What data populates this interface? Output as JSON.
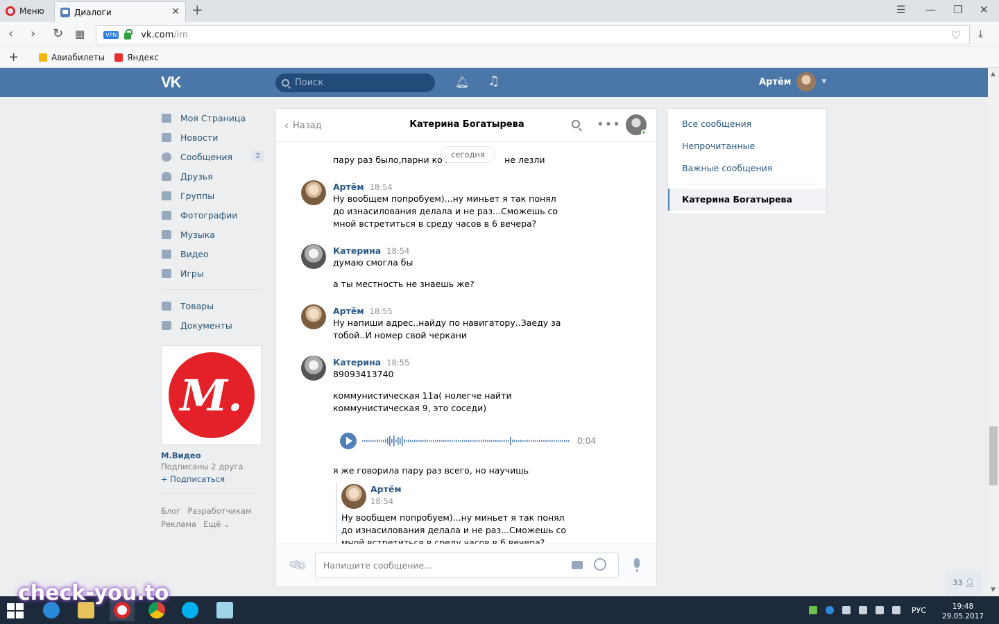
{
  "browser": {
    "menu_label": "Меню",
    "tab_title": "Диалоги",
    "url_host": "vk.com",
    "url_path": "/im",
    "vpn_label": "VPN",
    "bookmarks": [
      {
        "label": "Авиабилеты",
        "color": "#f7b500"
      },
      {
        "label": "Яндекс",
        "color": "#e8302a"
      }
    ]
  },
  "vk_header": {
    "logo": "VK",
    "search_placeholder": "Поиск",
    "user_name": "Артём"
  },
  "left_nav": {
    "items": [
      {
        "label": "Моя Страница",
        "icon": "home-icon"
      },
      {
        "label": "Новости",
        "icon": "news-icon"
      },
      {
        "label": "Сообщения",
        "icon": "messages-icon",
        "badge": "2"
      },
      {
        "label": "Друзья",
        "icon": "friends-icon"
      },
      {
        "label": "Группы",
        "icon": "groups-icon"
      },
      {
        "label": "Фотографии",
        "icon": "photos-icon"
      },
      {
        "label": "Музыка",
        "icon": "music-icon"
      },
      {
        "label": "Видео",
        "icon": "video-icon"
      },
      {
        "label": "Игры",
        "icon": "games-icon"
      }
    ],
    "items2": [
      {
        "label": "Товары",
        "icon": "market-icon"
      },
      {
        "label": "Документы",
        "icon": "documents-icon"
      }
    ]
  },
  "ad": {
    "logo_text": "М.",
    "name": "М.Видео",
    "subscribed": "Подписаны 2 друга",
    "subscribe": "+ Подписаться"
  },
  "footer": {
    "blog": "Блог",
    "developers": "Разработчикам",
    "ads": "Реклама",
    "more": "Ещё ⌄"
  },
  "chat": {
    "back_label": "Назад",
    "title": "Катерина Богатырева",
    "date_pill": "сегодня",
    "top_partial": "пару раз было,парни ко м",
    "top_partial_end": "не лезли",
    "messages": [
      {
        "author": "Артём",
        "time": "18:54",
        "lines": [
          "Ну вообщем попробуем)...ну миньет я так понял до изнасилования делала и не раз...Сможешь со мной встретиться в среду часов в 6 вечера?"
        ]
      },
      {
        "author": "Катерина",
        "time": "18:54",
        "lines": [
          "думаю смогла бы",
          "а ты местность не знаешь же?"
        ]
      },
      {
        "author": "Артём",
        "time": "18:55",
        "lines": [
          "Ну напиши адрес..найду по навигатору..Заеду за тобой..И номер свой черкани"
        ]
      },
      {
        "author": "Катерина",
        "time": "18:55",
        "lines": [
          "89093413740",
          "коммунистическая 11а( нолегче найти коммунистическая 9, это соседи)"
        ]
      }
    ],
    "voice_duration": "0:04",
    "after_voice": "я же говорила пару раз всего, но научишь",
    "forwarded": {
      "author": "Артём",
      "time": "18:54",
      "text": "Ну вообщем попробуем)...ну миньет я так понял до изнасилования делала и не раз...Сможешь со мной встретиться в среду часов в 6 вечера?"
    },
    "input_placeholder": "Напишите сообщение..."
  },
  "right_nav": {
    "all": "Все сообщения",
    "unread": "Непрочитанные",
    "important": "Важные сообщения",
    "active_dialog": "Катерина Богатырева"
  },
  "fab_count": "33",
  "taskbar": {
    "lang": "РУС",
    "time": "19:48",
    "date": "29.05.2017"
  },
  "watermark": "check-you.to",
  "colors": {
    "vk_blue": "#4a76a8",
    "link": "#2a5885",
    "opera_red": "#e0262b"
  }
}
